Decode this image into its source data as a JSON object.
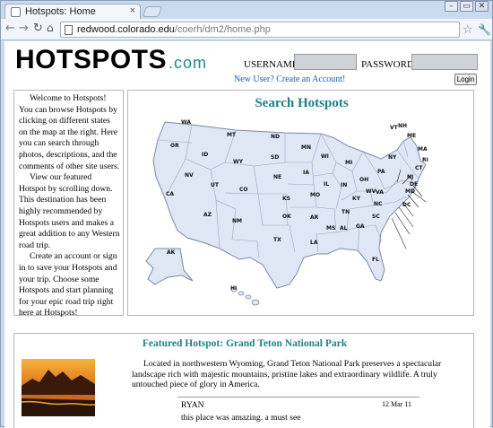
{
  "browser": {
    "tab_title": "Hotspots: Home",
    "tab_close": "×",
    "back_icon": "arrow-left",
    "forward_icon": "arrow-right",
    "reload_icon": "reload",
    "home_icon": "home",
    "url_domain": "redwood.colorado.edu",
    "url_path": "/coerh/dm2/home.php",
    "window_controls": [
      "–",
      "▭",
      "✕"
    ]
  },
  "header": {
    "logo_main": "HOTSPOTS",
    "logo_suffix": ".com",
    "username_label": "USERNAME:",
    "password_label": "PASSWORD:",
    "new_user_link": "New User? Create an Account!",
    "login_button": "Login"
  },
  "welcome": {
    "p1": "Welcome to Hotspots! You can browse Hotspots by clicking on different states on the map at the right. Here you can search through photos, descriptions, and the comments of other site users.",
    "p2": "View our featured Hotspot by scrolling down. This destination has been highly recommended by Hotspots users and makes a great addition to any Western road trip.",
    "p3": "Create an account or sign in to save your Hotspots and your trip. Choose some Hotspots and start planning for your epic road trip right here at Hotspots!"
  },
  "map": {
    "title": "Search Hotspots",
    "fill_color": "#dfe6f4",
    "border_color": "#7c8aa6",
    "states": [
      {
        "abbr": "WA"
      },
      {
        "abbr": "OR"
      },
      {
        "abbr": "CA"
      },
      {
        "abbr": "ID"
      },
      {
        "abbr": "NV"
      },
      {
        "abbr": "MT"
      },
      {
        "abbr": "WY"
      },
      {
        "abbr": "UT"
      },
      {
        "abbr": "AZ"
      },
      {
        "abbr": "CO"
      },
      {
        "abbr": "NM"
      },
      {
        "abbr": "ND"
      },
      {
        "abbr": "SD"
      },
      {
        "abbr": "NE"
      },
      {
        "abbr": "KS"
      },
      {
        "abbr": "OK"
      },
      {
        "abbr": "TX"
      },
      {
        "abbr": "MN"
      },
      {
        "abbr": "IA"
      },
      {
        "abbr": "MO"
      },
      {
        "abbr": "AR"
      },
      {
        "abbr": "LA"
      },
      {
        "abbr": "WI"
      },
      {
        "abbr": "IL"
      },
      {
        "abbr": "MI"
      },
      {
        "abbr": "IN"
      },
      {
        "abbr": "OH"
      },
      {
        "abbr": "KY"
      },
      {
        "abbr": "TN"
      },
      {
        "abbr": "MS"
      },
      {
        "abbr": "AL"
      },
      {
        "abbr": "GA"
      },
      {
        "abbr": "FL"
      },
      {
        "abbr": "SC"
      },
      {
        "abbr": "NC"
      },
      {
        "abbr": "VA"
      },
      {
        "abbr": "WV"
      },
      {
        "abbr": "PA"
      },
      {
        "abbr": "NY"
      },
      {
        "abbr": "VT"
      },
      {
        "abbr": "NH"
      },
      {
        "abbr": "ME"
      },
      {
        "abbr": "MA"
      },
      {
        "abbr": "RI"
      },
      {
        "abbr": "CT"
      },
      {
        "abbr": "NJ"
      },
      {
        "abbr": "DE"
      },
      {
        "abbr": "MD"
      },
      {
        "abbr": "DC"
      },
      {
        "abbr": "AK"
      },
      {
        "abbr": "HI"
      }
    ]
  },
  "featured": {
    "title": "Featured Hotspot: Grand Teton National Park",
    "description": "Located in northwestern Wyoming, Grand Teton National Park preserves a spectacular landscape rich with majestic mountains, pristine lakes and extraordinary wildlife. A truly untouched piece of glory in America.",
    "comment": {
      "user": "RYAN",
      "date": "12 Mar 11",
      "text": "this place was amazing. a must see"
    }
  }
}
